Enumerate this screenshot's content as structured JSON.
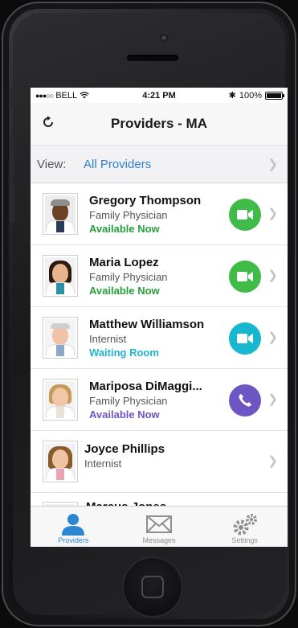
{
  "status_bar": {
    "carrier": "BELL",
    "time": "4:21 PM",
    "battery": "100%"
  },
  "nav": {
    "title": "Providers - MA",
    "refresh_icon": "refresh-icon"
  },
  "view": {
    "label": "View:",
    "value": "All Providers"
  },
  "providers": [
    {
      "name": "Gregory Thompson",
      "role": "Family Physician",
      "status": "Available Now",
      "status_color": "#27a03a",
      "call_type": "video",
      "call_color": "#3ebc47"
    },
    {
      "name": "Maria Lopez",
      "role": "Family Physician",
      "status": "Available Now",
      "status_color": "#27a03a",
      "call_type": "video",
      "call_color": "#3ebc47"
    },
    {
      "name": "Matthew Williamson",
      "role": "Internist",
      "status": "Waiting Room",
      "status_color": "#1fb4d0",
      "call_type": "video",
      "call_color": "#17b6d1"
    },
    {
      "name": "Mariposa DiMaggi...",
      "role": "Family Physician",
      "status": "Available Now",
      "status_color": "#6e55c4",
      "call_type": "phone",
      "call_color": "#6e55c4"
    },
    {
      "name": "Joyce Phillips",
      "role": "Internist",
      "status": "",
      "call_type": "none"
    },
    {
      "name": "Marcus Jones",
      "role": "",
      "status": "",
      "call_type": "none"
    }
  ],
  "tabs": [
    {
      "label": "Providers",
      "icon": "person-icon",
      "active": true
    },
    {
      "label": "Messages",
      "icon": "envelope-icon",
      "active": false
    },
    {
      "label": "Settings",
      "icon": "gears-icon",
      "active": false
    }
  ],
  "colors": {
    "accent": "#2b87d1",
    "link": "#2d7fd2"
  }
}
